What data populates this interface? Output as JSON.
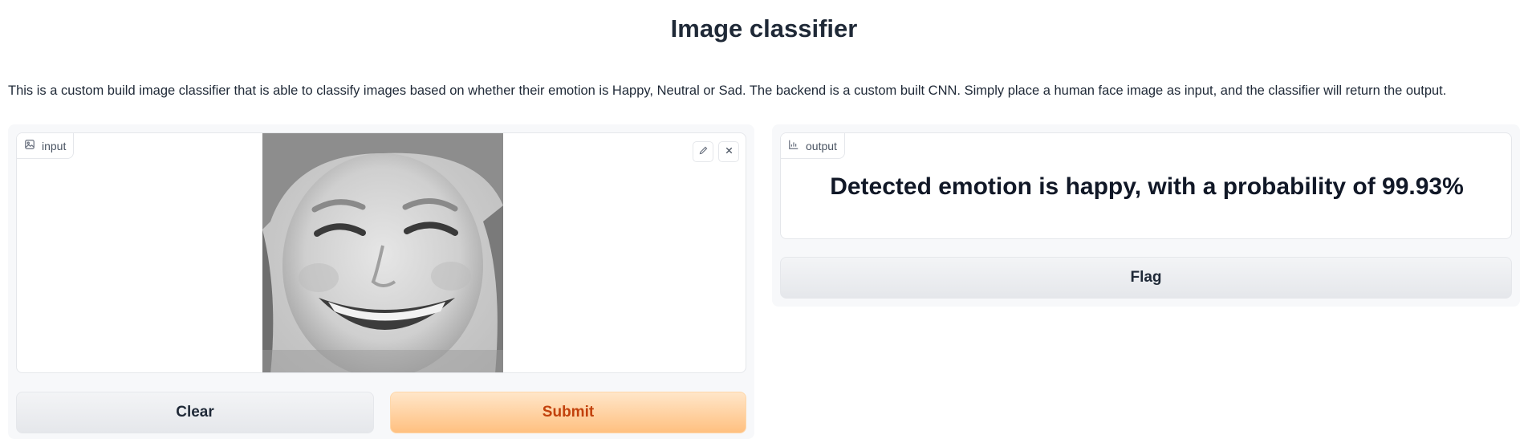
{
  "page": {
    "title": "Image classifier",
    "description": "This is a custom build image classifier that is able to classify images based on whether their emotion is Happy, Neutral or Sad. The backend is a custom built CNN. Simply place a human face image as input, and the classifier will return the output."
  },
  "input_panel": {
    "label": "input",
    "label_icon": "image-icon",
    "image_description": "grayscale smiling child face",
    "tools": [
      "edit-icon",
      "close-icon"
    ],
    "clear_label": "Clear",
    "submit_label": "Submit"
  },
  "output_panel": {
    "label": "output",
    "label_icon": "chart-icon",
    "result_text": "Detected emotion is happy, with a probability of 99.93%",
    "flag_label": "Flag"
  },
  "colors": {
    "accent": "#f97316",
    "submit_bg": "#ffc080",
    "panel_bg": "#f7f8fa"
  }
}
